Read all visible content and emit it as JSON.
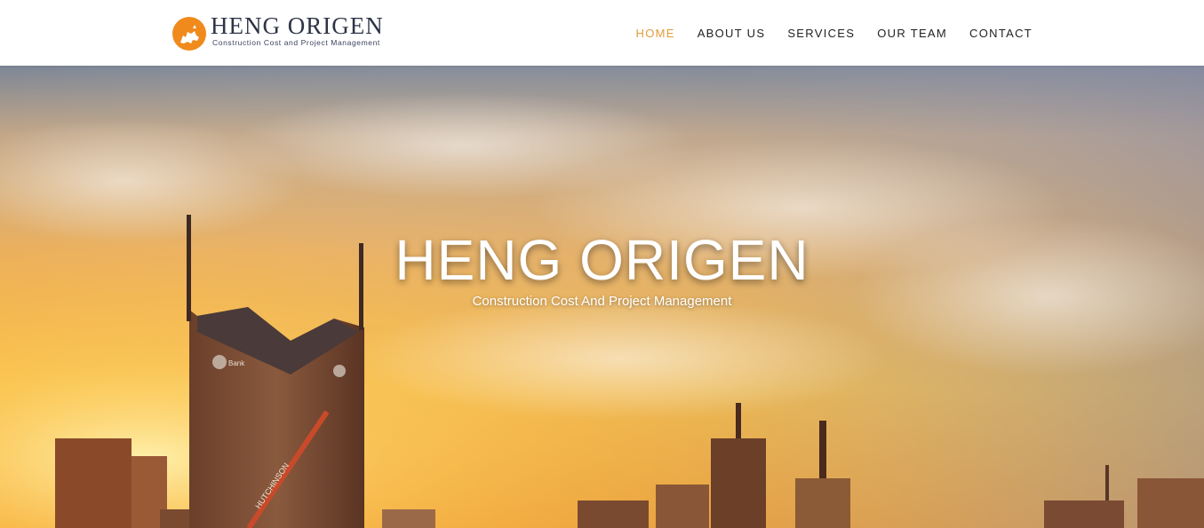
{
  "header": {
    "logo": {
      "title": "HENG ORIGEN",
      "subtitle": "Construction Cost and Project Management"
    },
    "nav": [
      {
        "label": "HOME",
        "active": true
      },
      {
        "label": "ABOUT US",
        "active": false
      },
      {
        "label": "SERVICES",
        "active": false
      },
      {
        "label": "OUR TEAM",
        "active": false
      },
      {
        "label": "CONTACT",
        "active": false
      }
    ]
  },
  "hero": {
    "title": "HENG ORIGEN",
    "subtitle": "Construction Cost And Project Management",
    "building_signs": [
      "Bank",
      "HUTCHINSON"
    ]
  },
  "colors": {
    "accent": "#e39b3a",
    "logo_orange": "#f08a1c",
    "nav_text": "#222222",
    "logo_text": "#2d3446"
  }
}
